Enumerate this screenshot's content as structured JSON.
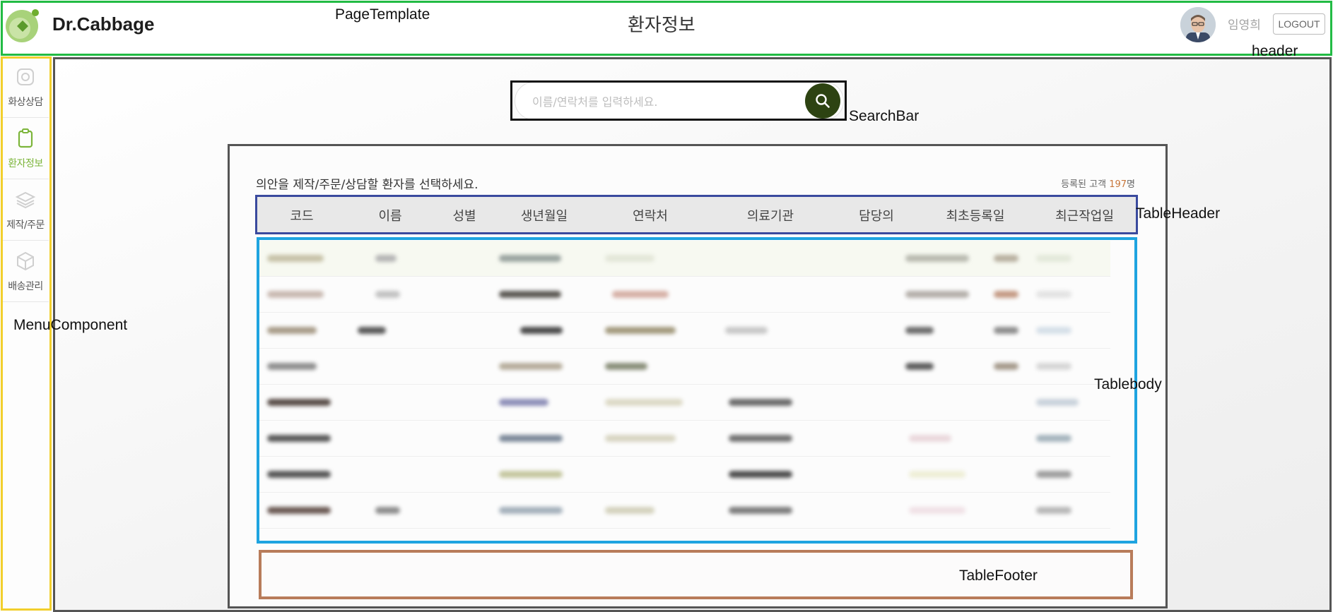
{
  "annotations": {
    "page_template": "PageTemplate",
    "header": "header",
    "search_bar": "SearchBar",
    "table_header": "TableHeader",
    "table_body": "Tablebody",
    "table_footer": "TableFooter",
    "menu_component": "MenuComponent"
  },
  "header": {
    "brand": "Dr.Cabbage",
    "page_title": "환자정보",
    "user_name": "임영희",
    "logout_label": "LOGOUT"
  },
  "menu": {
    "items": [
      {
        "label": "화상상담",
        "icon": "camera-icon",
        "active": false
      },
      {
        "label": "환자정보",
        "icon": "clipboard-icon",
        "active": true
      },
      {
        "label": "제작/주문",
        "icon": "layers-icon",
        "active": false
      },
      {
        "label": "배송관리",
        "icon": "box-icon",
        "active": false
      }
    ]
  },
  "search": {
    "placeholder": "이름/연락처를 입력하세요.",
    "value": "",
    "icon": "search-icon"
  },
  "table": {
    "instruction": "의안을 제작/주문/상담할 환자를 선택하세요.",
    "registered_prefix": "등록된 고객",
    "registered_count": "197",
    "registered_suffix": "명",
    "columns": [
      "코드",
      "이름",
      "성별",
      "생년월일",
      "연락처",
      "의료기관",
      "담당의",
      "최초등록일",
      "최근작업일"
    ]
  },
  "colors": {
    "accent_green": "#7cb53a",
    "search_button": "#2d4312",
    "count_highlight": "#c8763a"
  }
}
